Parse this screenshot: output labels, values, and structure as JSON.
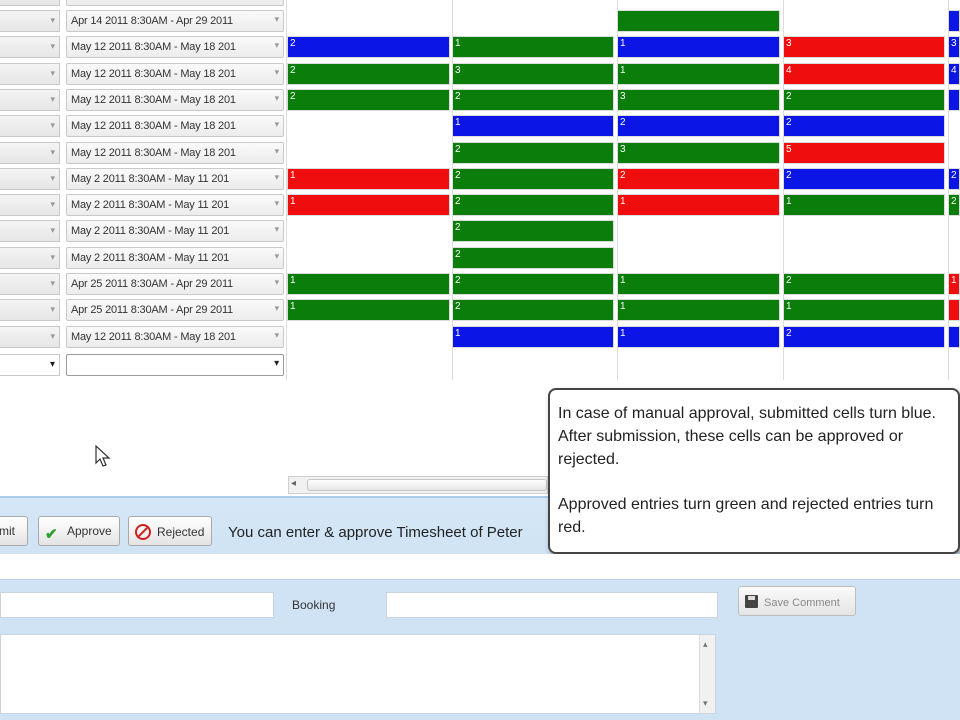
{
  "grid": {
    "rows": [
      {
        "date": "Apr 14 2011  8:30AM - Apr 29 2011",
        "cells": [
          null,
          null,
          "green",
          null,
          "blue"
        ],
        "labels": [
          "",
          "",
          "",
          "",
          ""
        ]
      },
      {
        "date": "May 12 2011  8:30AM - May 18 201",
        "cells": [
          "blue",
          "green",
          "blue",
          "red",
          "blue"
        ],
        "labels": [
          "2",
          "1",
          "1",
          "3",
          "3"
        ]
      },
      {
        "date": "May 12 2011  8:30AM - May 18 201",
        "cells": [
          "green",
          "green",
          "green",
          "red",
          "blue"
        ],
        "labels": [
          "2",
          "3",
          "1",
          "4",
          "4"
        ]
      },
      {
        "date": "May 12 2011  8:30AM - May 18 201",
        "cells": [
          "green",
          "green",
          "green",
          "green",
          "blue"
        ],
        "labels": [
          "2",
          "2",
          "3",
          "2",
          ""
        ]
      },
      {
        "date": "May 12 2011  8:30AM - May 18 201",
        "cells": [
          null,
          "blue",
          "blue",
          "blue",
          null
        ],
        "labels": [
          "",
          "1",
          "2",
          "2",
          ""
        ]
      },
      {
        "date": "May 12 2011  8:30AM - May 18 201",
        "cells": [
          null,
          "green",
          "green",
          "red",
          null
        ],
        "labels": [
          "",
          "2",
          "3",
          "5",
          ""
        ]
      },
      {
        "date": "May  2 2011  8:30AM - May 11 201",
        "cells": [
          "red",
          "green",
          "red",
          "blue",
          "blue"
        ],
        "labels": [
          "1",
          "2",
          "2",
          "2",
          "2"
        ]
      },
      {
        "date": "May  2 2011  8:30AM - May 11 201",
        "cells": [
          "red",
          "green",
          "red",
          "green",
          "green"
        ],
        "labels": [
          "1",
          "2",
          "1",
          "1",
          "2"
        ]
      },
      {
        "date": "May  2 2011  8:30AM - May 11 201",
        "cells": [
          null,
          "green",
          null,
          null,
          null
        ],
        "labels": [
          "",
          "2",
          "",
          "",
          ""
        ]
      },
      {
        "date": "May  2 2011  8:30AM - May 11 201",
        "cells": [
          null,
          "green",
          null,
          null,
          null
        ],
        "labels": [
          "",
          "2",
          "",
          "",
          ""
        ]
      },
      {
        "date": "Apr 25 2011  8:30AM - Apr 29 2011",
        "cells": [
          "green",
          "green",
          "green",
          "green",
          "red"
        ],
        "labels": [
          "1",
          "2",
          "1",
          "2",
          "1"
        ]
      },
      {
        "date": "Apr 25 2011  8:30AM - Apr 29 2011",
        "cells": [
          "green",
          "green",
          "green",
          "green",
          "red"
        ],
        "labels": [
          "1",
          "2",
          "1",
          "1",
          ""
        ]
      },
      {
        "date": "May 12 2011  8:30AM - May 18 201",
        "cells": [
          null,
          "blue",
          "blue",
          "blue",
          "blue"
        ],
        "labels": [
          "",
          "1",
          "1",
          "2",
          ""
        ]
      }
    ]
  },
  "toolbar": {
    "submit_label": "mit",
    "approve_label": "Approve",
    "rejected_label": "Rejected",
    "message": "You can enter & approve Timesheet of Peter"
  },
  "callout": {
    "paragraph1": "In case of manual approval, submitted cells turn blue. After submission, these cells can be approved or rejected.",
    "paragraph2": "Approved entries turn green and rejected entries turn red."
  },
  "form": {
    "booking_label": "Booking",
    "save_comment_label": "Save Comment"
  },
  "colors": {
    "blue": "#0a15e6",
    "green": "#0a7d0a",
    "red": "#ef0d0d",
    "toolbar_bg": "#d6e8f7"
  },
  "icons": [
    "chevron-down-icon",
    "check-icon",
    "no-entry-icon",
    "floppy-disk-icon",
    "scroll-left-arrow-icon",
    "scroll-up-arrow-icon",
    "scroll-down-arrow-icon",
    "mouse-pointer-icon"
  ]
}
